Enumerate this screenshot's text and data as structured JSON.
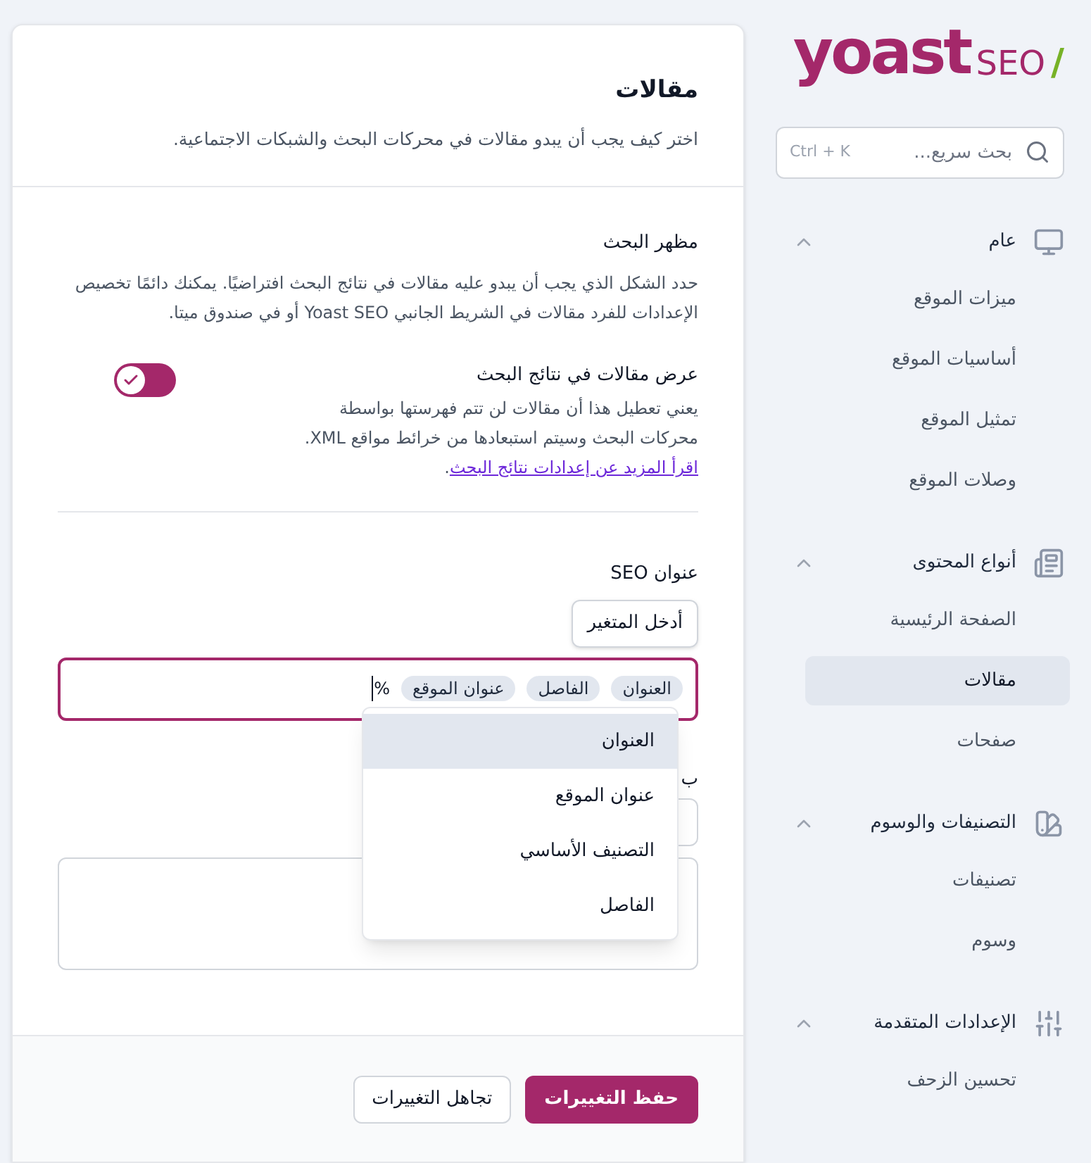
{
  "sidebar": {
    "logo": {
      "brand": "yoast",
      "product": "SEO",
      "slash": "/"
    },
    "search": {
      "placeholder": "بحث سريع...",
      "shortcut": "Ctrl + K"
    },
    "groups": [
      {
        "label": "عام",
        "kind": "monitor",
        "expanded": true,
        "items": [
          {
            "label": "ميزات الموقع",
            "selected": false
          },
          {
            "label": "أساسيات الموقع",
            "selected": false
          },
          {
            "label": "تمثيل الموقع",
            "selected": false
          },
          {
            "label": "وصلات الموقع",
            "selected": false
          }
        ]
      },
      {
        "label": "أنواع المحتوى",
        "kind": "newspaper",
        "expanded": true,
        "items": [
          {
            "label": "الصفحة الرئيسية",
            "selected": false
          },
          {
            "label": "مقالات",
            "selected": true
          },
          {
            "label": "صفحات",
            "selected": false
          }
        ]
      },
      {
        "label": "التصنيفات والوسوم",
        "kind": "swatch",
        "expanded": true,
        "items": [
          {
            "label": "تصنيفات",
            "selected": false
          },
          {
            "label": "وسوم",
            "selected": false
          }
        ]
      },
      {
        "label": "الإعدادات المتقدمة",
        "kind": "sliders",
        "expanded": true,
        "items": [
          {
            "label": "تحسين الزحف",
            "selected": false
          }
        ]
      }
    ]
  },
  "main": {
    "title": "مقالات",
    "description": "اختر كيف يجب أن يبدو مقالات في محركات البحث والشبكات الاجتماعية.",
    "section": {
      "heading": "مظهر البحث",
      "description": "حدد الشكل الذي يجب أن يبدو عليه مقالات في نتائج البحث افتراضيًا. يمكنك دائمًا تخصيص الإعدادات للفرد مقالات في الشريط الجانبي Yoast SEO أو في صندوق ميتا.",
      "toggle": {
        "label": "عرض مقالات في نتائج البحث",
        "on": true,
        "description": "يعني تعطيل هذا أن مقالات لن تتم فهرستها بواسطة محركات البحث وسيتم استبعادها من خرائط مواقع XML.",
        "link": "اقرأ المزيد عن إعدادات نتائج البحث",
        "after": "."
      }
    },
    "seo_title": {
      "label": "عنوان SEO",
      "insert_button": "أدخل المتغير",
      "tokens": [
        "العنوان",
        "الفاصل",
        "عنوان الموقع"
      ],
      "typed": "%",
      "suggestions": [
        {
          "label": "العنوان",
          "selected": true
        },
        {
          "label": "عنوان الموقع",
          "selected": false
        },
        {
          "label": "التصنيف الأساسي",
          "selected": false
        },
        {
          "label": "الفاصل",
          "selected": false
        }
      ]
    },
    "meta_description": {
      "label": "ب"
    }
  },
  "footer": {
    "save": "حفظ التغييرات",
    "discard": "تجاهل التغييرات"
  }
}
